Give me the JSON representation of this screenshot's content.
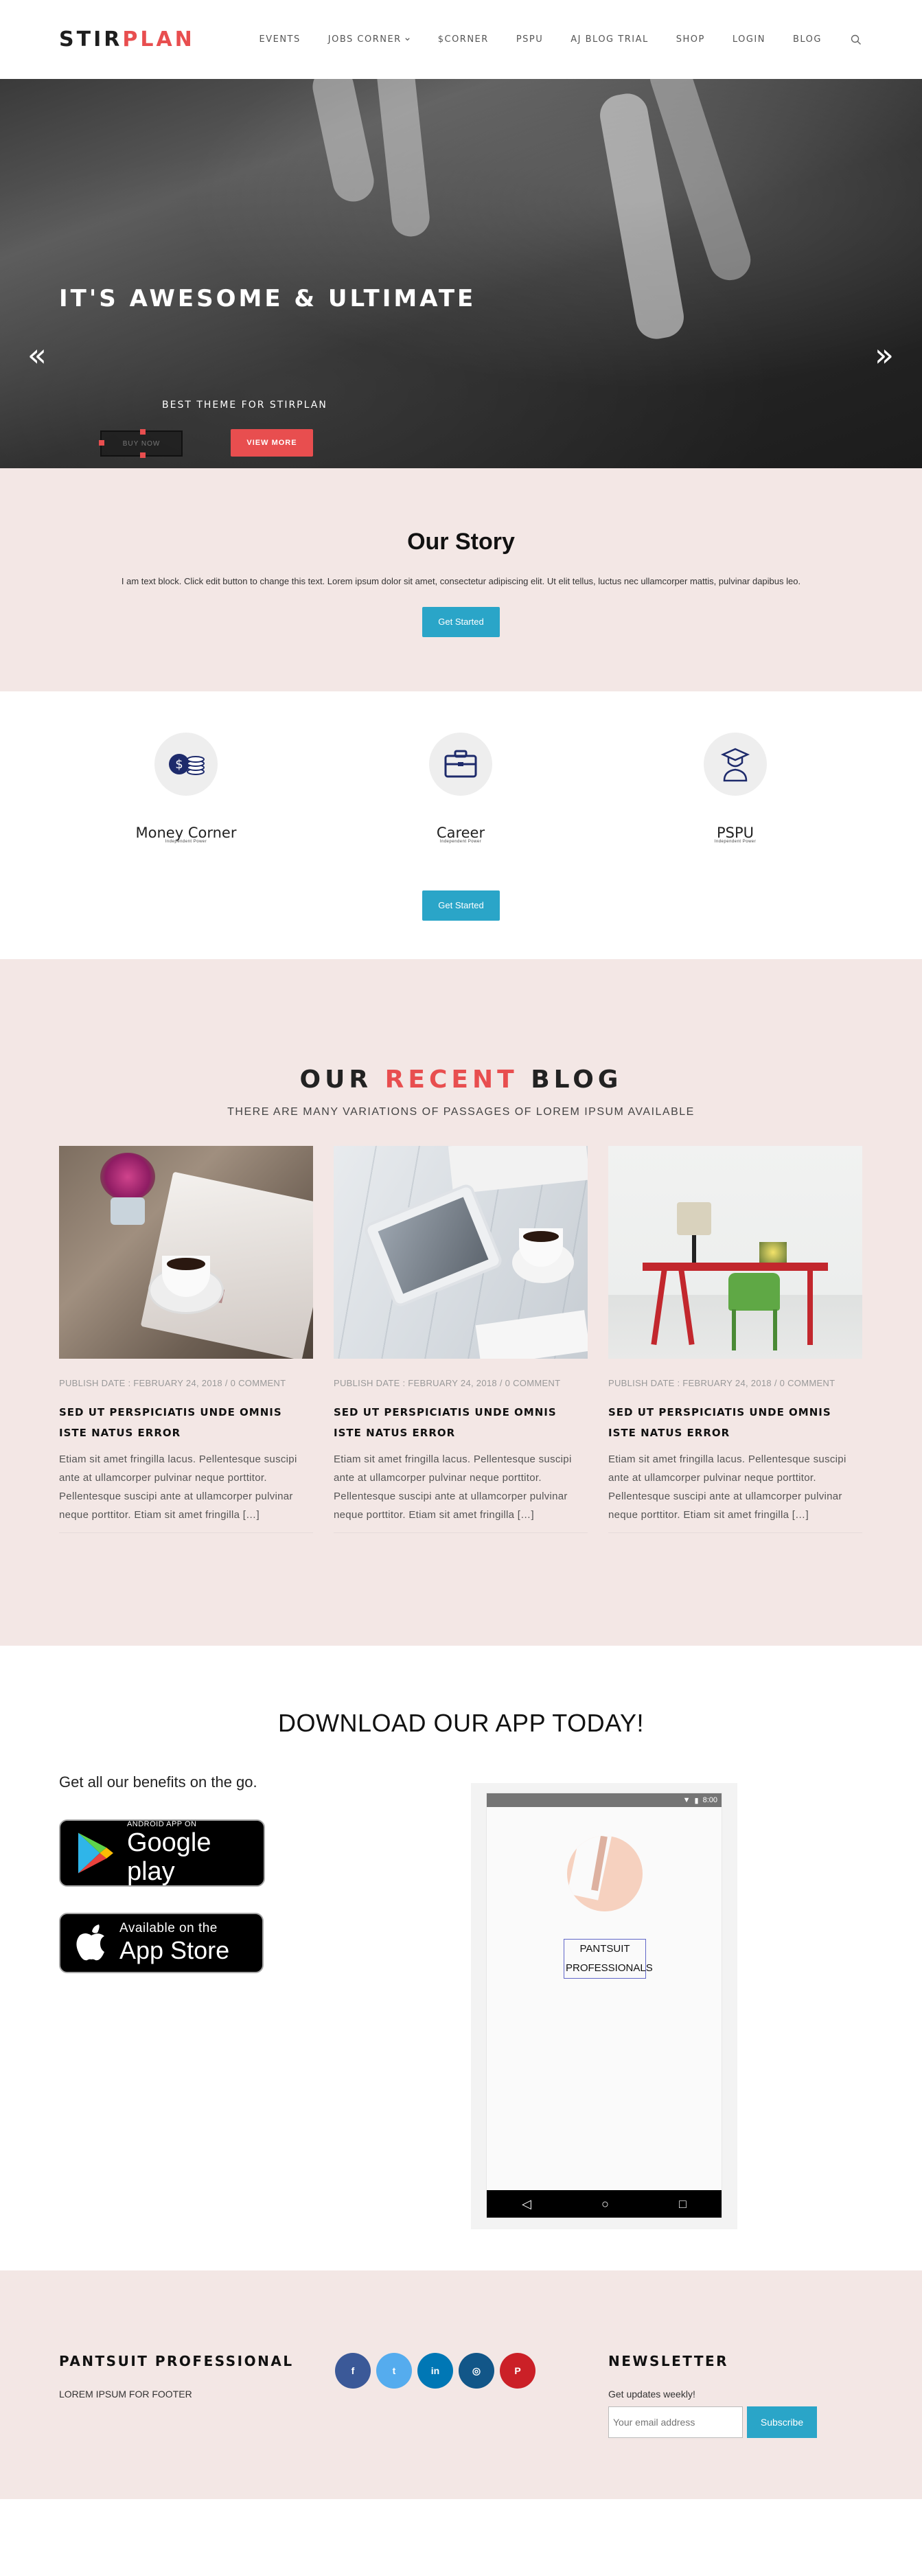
{
  "header": {
    "logo_part1": "STIR",
    "logo_part2": "PLAN",
    "nav": [
      "EVENTS",
      "JOBS CORNER",
      "$CORNER",
      "PSPU",
      "AJ BLOG TRIAL",
      "SHOP",
      "LOGIN",
      "BLOG"
    ]
  },
  "hero": {
    "title": "IT'S AWESOME & ULTIMATE",
    "subtitle": "BEST THEME FOR STIRPLAN",
    "outline_button": "BUY NOW",
    "view_button": "VIEW MORE",
    "prev_arrow": "«",
    "next_arrow": "»",
    "slides_count": 4
  },
  "story": {
    "title": "Our Story",
    "text": "I am text block. Click edit button to change this text. Lorem ipsum dolor sit amet, consectetur adipiscing elit. Ut elit tellus, luctus nec ullamcorper mattis, pulvinar dapibus leo.",
    "button": "Get Started"
  },
  "features": {
    "items": [
      {
        "label": "Money Corner",
        "sub": "Independent Power",
        "icon": "money-icon"
      },
      {
        "label": "Career",
        "sub": "Independent Power",
        "icon": "briefcase-icon"
      },
      {
        "label": "PSPU",
        "sub": "Independent Power",
        "icon": "graduate-icon"
      }
    ],
    "button": "Get Started"
  },
  "blog": {
    "title_part1": "OUR",
    "title_accent": "RECENT",
    "title_part2": "BLOG",
    "subtitle": "THERE ARE MANY VARIATIONS OF PASSAGES OF LOREM IPSUM AVAILABLE",
    "posts": [
      {
        "meta": "PUBLISH DATE : FEBRUARY 24, 2018 / 0 COMMENT",
        "title": "SED UT PERSPICIATIS UNDE OMNIS ISTE NATUS ERROR",
        "excerpt": "Etiam sit amet fringilla lacus. Pellentesque suscipi ante at ullamcorper pulvinar neque porttitor. Pellentesque suscipi ante at ullamcorper pulvinar neque porttitor. Etiam sit amet fringilla […]"
      },
      {
        "meta": "PUBLISH DATE : FEBRUARY 24, 2018 / 0 COMMENT",
        "title": "SED UT PERSPICIATIS UNDE OMNIS ISTE NATUS ERROR",
        "excerpt": "Etiam sit amet fringilla lacus. Pellentesque suscipi ante at ullamcorper pulvinar neque porttitor. Pellentesque suscipi ante at ullamcorper pulvinar neque porttitor. Etiam sit amet fringilla […]"
      },
      {
        "meta": "PUBLISH DATE : FEBRUARY 24, 2018 / 0 COMMENT",
        "title": "SED UT PERSPICIATIS UNDE OMNIS ISTE NATUS ERROR",
        "excerpt": "Etiam sit amet fringilla lacus. Pellentesque suscipi ante at ullamcorper pulvinar neque porttitor. Pellentesque suscipi ante at ullamcorper pulvinar neque porttitor. Etiam sit amet fringilla […]"
      }
    ]
  },
  "app": {
    "title": "DOWNLOAD OUR APP TODAY!",
    "lead": "Get all our benefits on the go.",
    "google": {
      "small": "ANDROID APP ON",
      "big": "Google play"
    },
    "apple": {
      "small": "Available on the",
      "big": "App Store"
    },
    "phone": {
      "time": "8:00",
      "brand_line1": "PANTSUIT",
      "brand_line2": "PROFESSIONALS"
    }
  },
  "footer": {
    "brand_title": "PANTSUIT PROFESSIONAL",
    "brand_text": "LOREM IPSUM FOR FOOTER",
    "socials": [
      {
        "name": "facebook-icon",
        "glyph": "f",
        "color": "#3b5998"
      },
      {
        "name": "twitter-icon",
        "glyph": "t",
        "color": "#55acee"
      },
      {
        "name": "linkedin-icon",
        "glyph": "in",
        "color": "#0077b5"
      },
      {
        "name": "instagram-icon",
        "glyph": "◎",
        "color": "#125688"
      },
      {
        "name": "pinterest-icon",
        "glyph": "P",
        "color": "#cb2027"
      }
    ],
    "newsletter_title": "NEWSLETTER",
    "newsletter_text": "Get updates weekly!",
    "email_placeholder": "Your email address",
    "subscribe": "Subscribe"
  },
  "colors": {
    "accent": "#e84e4f",
    "blue": "#2aa5c8",
    "pink_bg": "#f3e7e5"
  }
}
